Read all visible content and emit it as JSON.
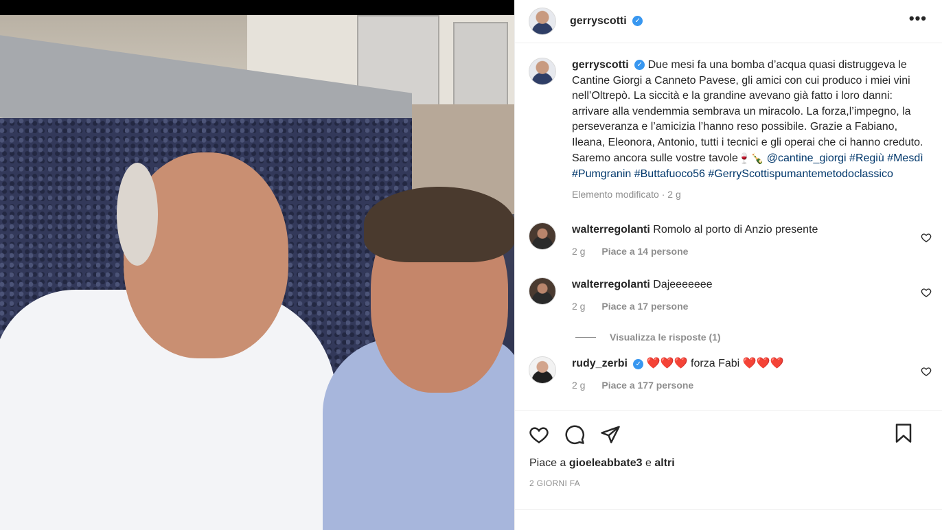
{
  "post": {
    "username": "gerryscotti",
    "verified": true,
    "caption": {
      "username": "gerryscotti",
      "text": "Due mesi fa una bomba d’acqua quasi distruggeva le Cantine Giorgi a Canneto Pavese, gli amici con cui produco i miei vini nell’Oltrepò. La siccità e la grandine avevano già fatto i loro danni: arrivare alla vendemmia sembrava un miracolo. La forza,l’impegno, la perseveranza e l’amicizia l’hanno reso possibile. Grazie a Fabiano, Ileana, Eleonora, Antonio, tutti i tecnici e gli operai che ci hanno creduto. Saremo ancora sulle vostre tavole",
      "emojis": "🍷🍾",
      "tags": [
        "@cantine_giorgi",
        "#Regiù",
        "#Mesdì",
        "#Pumgranin",
        "#Buttafuoco56",
        "#GerryScottispumantemetodoclassico"
      ],
      "meta": "Elemento modificato · 2 g"
    },
    "comments": [
      {
        "username": "walterregolanti",
        "text": "Romolo al porto di Anzio presente",
        "time": "2 g",
        "likes": "Piace a 14 persone"
      },
      {
        "username": "walterregolanti",
        "text": "Dajeeeeeee",
        "time": "2 g",
        "likes": "Piace a 17 persone",
        "replies": "Visualizza le risposte (1)"
      },
      {
        "username": "rudy_zerbi",
        "verified": true,
        "hearts_before": "❤️❤️❤️",
        "text": "forza Fabi",
        "hearts_after": "❤️❤️❤️",
        "time": "2 g",
        "likes": "Piace a 177 persone"
      }
    ],
    "likes_prefix": "Piace a",
    "likes_user": "gioeleabbate3",
    "likes_join": "e",
    "likes_suffix": "altri",
    "date": "2 GIORNI FA"
  },
  "icons": {
    "more": "more-options-icon",
    "like": "heart-icon",
    "comment": "comment-icon",
    "share": "share-icon",
    "save": "bookmark-icon",
    "verified_color": "#3897f0"
  }
}
